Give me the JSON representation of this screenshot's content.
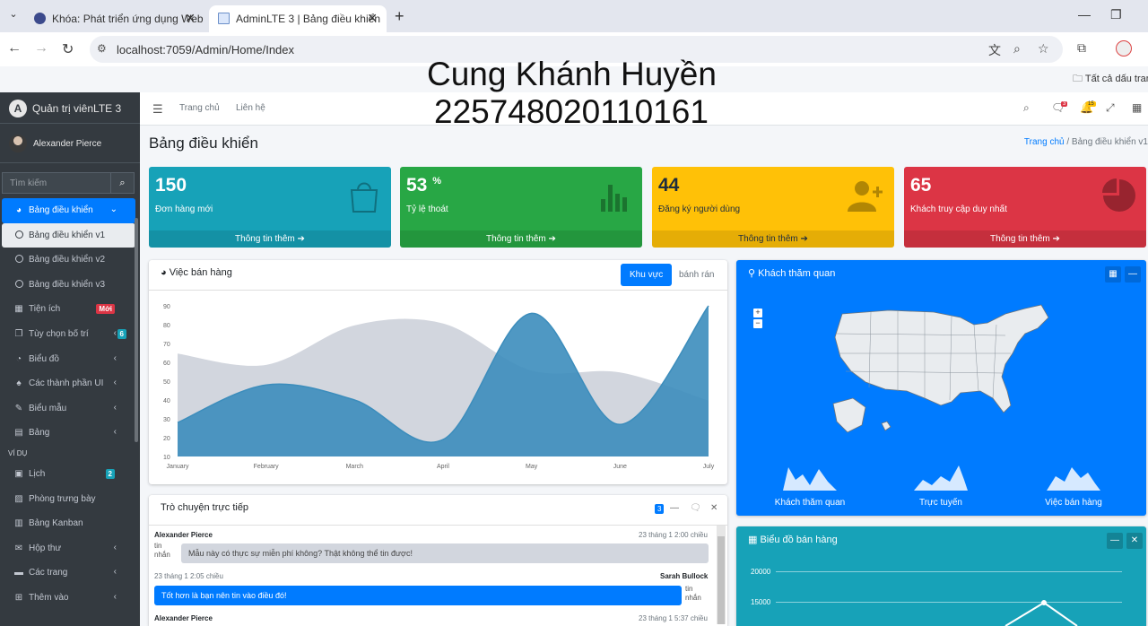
{
  "browser": {
    "tabs": [
      {
        "title": "Khóa: Phát triển ứng dụng Web"
      },
      {
        "title": "AdminLTE 3 | Bảng điều khiển"
      }
    ],
    "url": "localhost:7059/Admin/Home/Index",
    "bookmarks_label": "Tất cả dấu trang"
  },
  "overlay": {
    "name": "Cung Khánh Huyền",
    "student_id": "2257480201101​61"
  },
  "sidebar": {
    "brand": "Quản trị viênLTE 3",
    "user": "Alexander Pierce",
    "search_placeholder": "Tìm kiếm",
    "items": [
      {
        "label": "Bảng điều khiển",
        "icon": "dashboard-icon"
      },
      {
        "label": "Bảng điều khiển v1",
        "icon": "circle-icon"
      },
      {
        "label": "Bảng điều khiển v2",
        "icon": "circle-icon"
      },
      {
        "label": "Bảng điều khiển v3",
        "icon": "circle-icon"
      },
      {
        "label": "Tiện ích",
        "icon": "widgets-icon",
        "badge": "Mới"
      },
      {
        "label": "Tùy chọn bố trí",
        "icon": "copy-icon",
        "badge": "6"
      },
      {
        "label": "Biểu đồ",
        "icon": "chart-pie-icon"
      },
      {
        "label": "Các thành phần UI",
        "icon": "tree-icon"
      },
      {
        "label": "Biểu mẫu",
        "icon": "edit-icon"
      },
      {
        "label": "Bảng",
        "icon": "table-icon"
      }
    ],
    "section_examples": "VÍ DỤ",
    "examples": [
      {
        "label": "Lịch",
        "icon": "calendar-icon",
        "badge": "2"
      },
      {
        "label": "Phòng trưng bày",
        "icon": "image-icon"
      },
      {
        "label": "Bảng Kanban",
        "icon": "columns-icon"
      },
      {
        "label": "Hộp thư",
        "icon": "envelope-icon"
      },
      {
        "label": "Các trang",
        "icon": "book-icon"
      },
      {
        "label": "Thêm vào",
        "icon": "plus-square-icon"
      }
    ]
  },
  "topnav": {
    "home": "Trang chủ",
    "contact": "Liên hệ",
    "messages_badge": "3",
    "notifications_badge": "15"
  },
  "page": {
    "title": "Bảng điều khiển",
    "breadcrumb": [
      "Trang chủ",
      "Bảng điều khiển v1"
    ]
  },
  "small_boxes": [
    {
      "value": "150",
      "sup": "",
      "label": "Đơn hàng mới",
      "more": "Thông tin thêm",
      "color": "#17a2b8",
      "icon": "shopping-bag-icon"
    },
    {
      "value": "53",
      "sup": "%",
      "label": "Tỷ lệ thoát",
      "more": "Thông tin thêm",
      "color": "#28a745",
      "icon": "stats-bars-icon"
    },
    {
      "value": "44",
      "sup": "",
      "label": "Đăng ký người dùng",
      "more": "Thông tin thêm",
      "color": "#ffc107",
      "icon": "person-add-icon"
    },
    {
      "value": "65",
      "sup": "",
      "label": "Khách truy cập duy nhất",
      "more": "Thông tin thêm",
      "color": "#dc3545",
      "icon": "pie-graph-icon"
    }
  ],
  "sales_card": {
    "title": "Việc bán hàng",
    "tab_area": "Khu vực",
    "tab_donut": "bánh rán"
  },
  "chart_data": {
    "type": "area",
    "categories": [
      "January",
      "February",
      "March",
      "April",
      "May",
      "June",
      "July"
    ],
    "ylim": [
      10,
      90
    ],
    "yticks": [
      10,
      20,
      30,
      40,
      50,
      60,
      70,
      80,
      90
    ],
    "series": [
      {
        "values": [
          65,
          59,
          80,
          81,
          56,
          55,
          40
        ],
        "color": "#d2d6de"
      },
      {
        "values": [
          28,
          48,
          40,
          19,
          86,
          27,
          90
        ],
        "color": "#3c8dbc"
      }
    ]
  },
  "visitors_card": {
    "title": "Khách thăm quan",
    "sparks": [
      "Khách thăm quan",
      "Trực tuyến",
      "Việc bán hàng"
    ]
  },
  "chat_card": {
    "title": "Trò chuyện trực tiếp",
    "badge": "3",
    "messages": [
      {
        "name": "Alexander Pierce",
        "time": "23 tháng 1 2:00 chiều",
        "text": "Mẫu này có thực sự miễn phí không? Thật không thể tin được!",
        "img_alt": "tin nhắn"
      },
      {
        "name": "Sarah Bullock",
        "time": "23 tháng 1 2:05 chiều",
        "text": "Tốt hơn là bạn nên tin vào điều đó!",
        "img_alt": "tin nhắn"
      },
      {
        "name": "Alexander Pierce",
        "time": "23 tháng 1 5:37 chiều"
      }
    ]
  },
  "graph_card": {
    "title": "Biểu đồ bán hàng",
    "yticks": [
      "20000",
      "15000"
    ]
  }
}
